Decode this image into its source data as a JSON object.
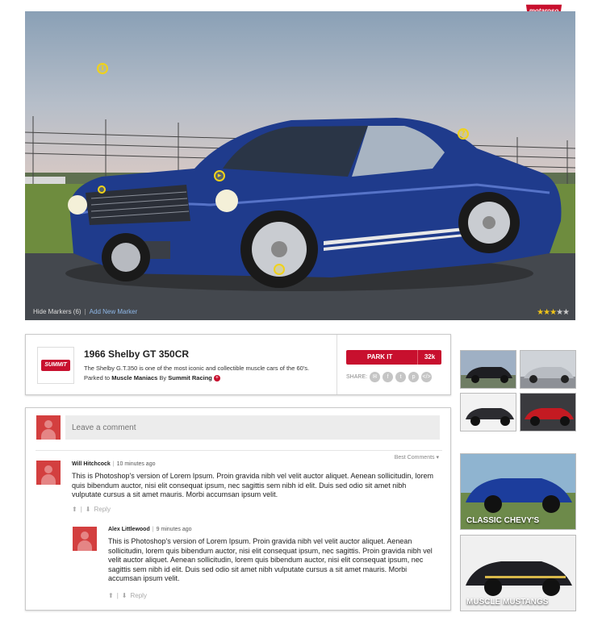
{
  "brand": {
    "logo_text": "motaroso",
    "accent": "#c8102e"
  },
  "hero": {
    "hide_markers": "Hide Markers (6)",
    "separator": "|",
    "add_marker": "Add New Marker",
    "rating": 3,
    "rating_max": 5,
    "markers": [
      "info",
      "question",
      "play",
      "dot",
      "dot",
      "dot"
    ]
  },
  "card": {
    "sponsor_logo_text": "SUMMIT",
    "title": "1966 Shelby GT 350CR",
    "description": "The Shelby G.T.350 is one of the most iconic and collectible muscle cars of the 60's.",
    "parked_prefix": "Parked to",
    "parked_group": "Muscle Maniacs",
    "parked_by": "By",
    "parked_user": "Summit Racing",
    "park_label": "PARK IT",
    "park_count": "32k",
    "share_label": "SHARE:",
    "share_icons": [
      "mail-icon",
      "facebook-icon",
      "twitter-icon",
      "pinterest-icon",
      "embed-icon"
    ]
  },
  "comments": {
    "placeholder": "Leave a comment",
    "sort_label": "Best Comments",
    "items": [
      {
        "author": "Will Hitchcock",
        "time": "10 minutes ago",
        "text": "This is Photoshop's version of Lorem Ipsum. Proin gravida nibh vel velit auctor aliquet. Aenean sollicitudin, lorem quis bibendum auctor, nisi elit consequat ipsum, nec sagittis sem nibh id elit. Duis sed odio sit amet nibh vulputate cursus a sit amet mauris. Morbi accumsan ipsum velit.",
        "reply": "Reply"
      },
      {
        "author": "Alex Littlewood",
        "time": "9 minutes ago",
        "text": "This is Photoshop's version of Lorem Ipsum. Proin gravida nibh vel velit auctor aliquet. Aenean sollicitudin, lorem quis bibendum auctor, nisi elit consequat ipsum, nec sagittis. Proin gravida nibh vel velit auctor aliquet. Aenean sollicitudin, lorem quis bibendum auctor, nisi elit consequat ipsum, nec sagittis sem nibh id elit. Duis sed odio sit amet nibh vulputate cursus a sit amet mauris. Morbi accumsan ipsum velit.",
        "reply": "Reply"
      }
    ]
  },
  "sidebar": {
    "related_caption_1": "CLASSIC CHEVY'S",
    "related_caption_2": "MUSCLE MUSTANGS"
  }
}
